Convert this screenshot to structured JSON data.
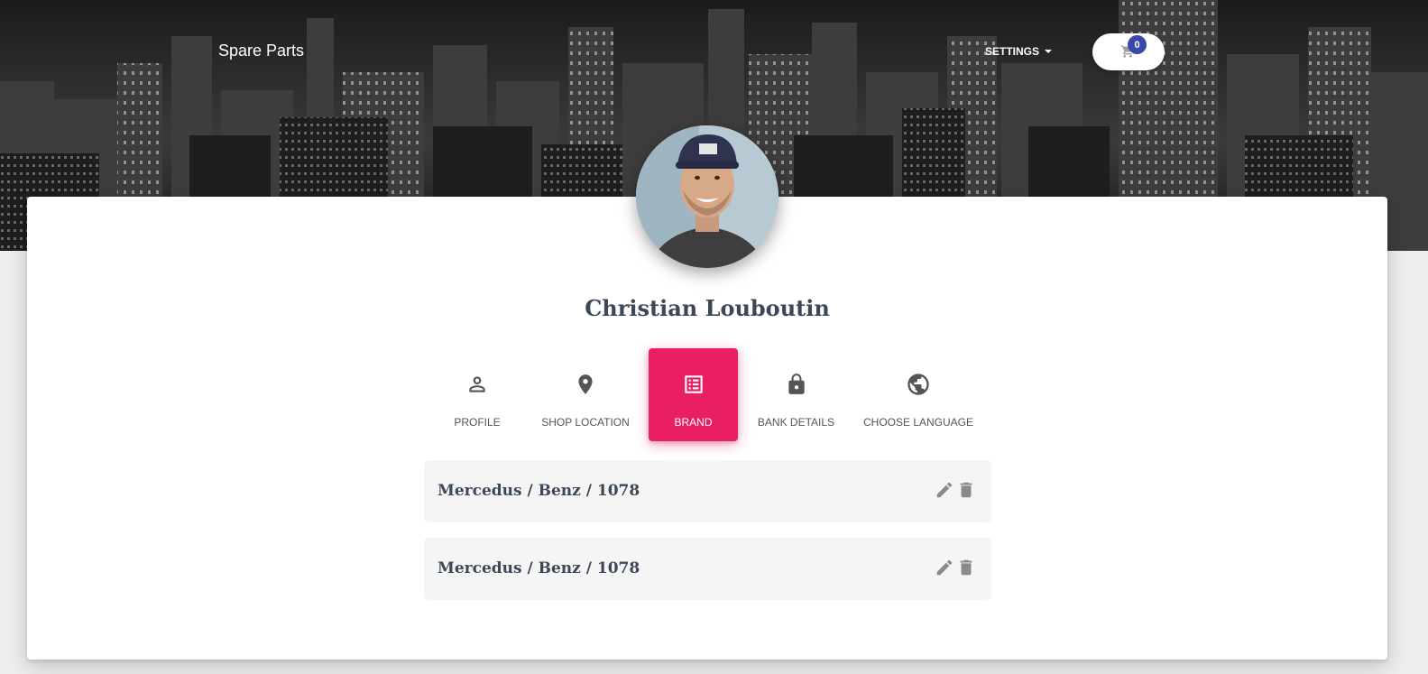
{
  "navbar": {
    "brand": "Spare Parts",
    "settings_label": "SETTINGS",
    "cart_count": "0"
  },
  "profile": {
    "name": "Christian Louboutin",
    "avatar_icon": "user-avatar-photo"
  },
  "tabs": [
    {
      "label": "PROFILE",
      "icon": "person-icon",
      "active": false
    },
    {
      "label": "SHOP LOCATION",
      "icon": "location-pin-icon",
      "active": false
    },
    {
      "label": "BRAND",
      "icon": "list-icon",
      "active": true
    },
    {
      "label": "BANK DETAILS",
      "icon": "lock-icon",
      "active": false
    },
    {
      "label": "CHOOSE LANGUAGE",
      "icon": "globe-icon",
      "active": false
    }
  ],
  "brands": [
    {
      "text": "Mercedus / Benz / 1078"
    },
    {
      "text": "Mercedus / Benz / 1078"
    }
  ],
  "colors": {
    "accent": "#e91e63",
    "badge": "#3949ab",
    "heading": "#3c4858"
  }
}
